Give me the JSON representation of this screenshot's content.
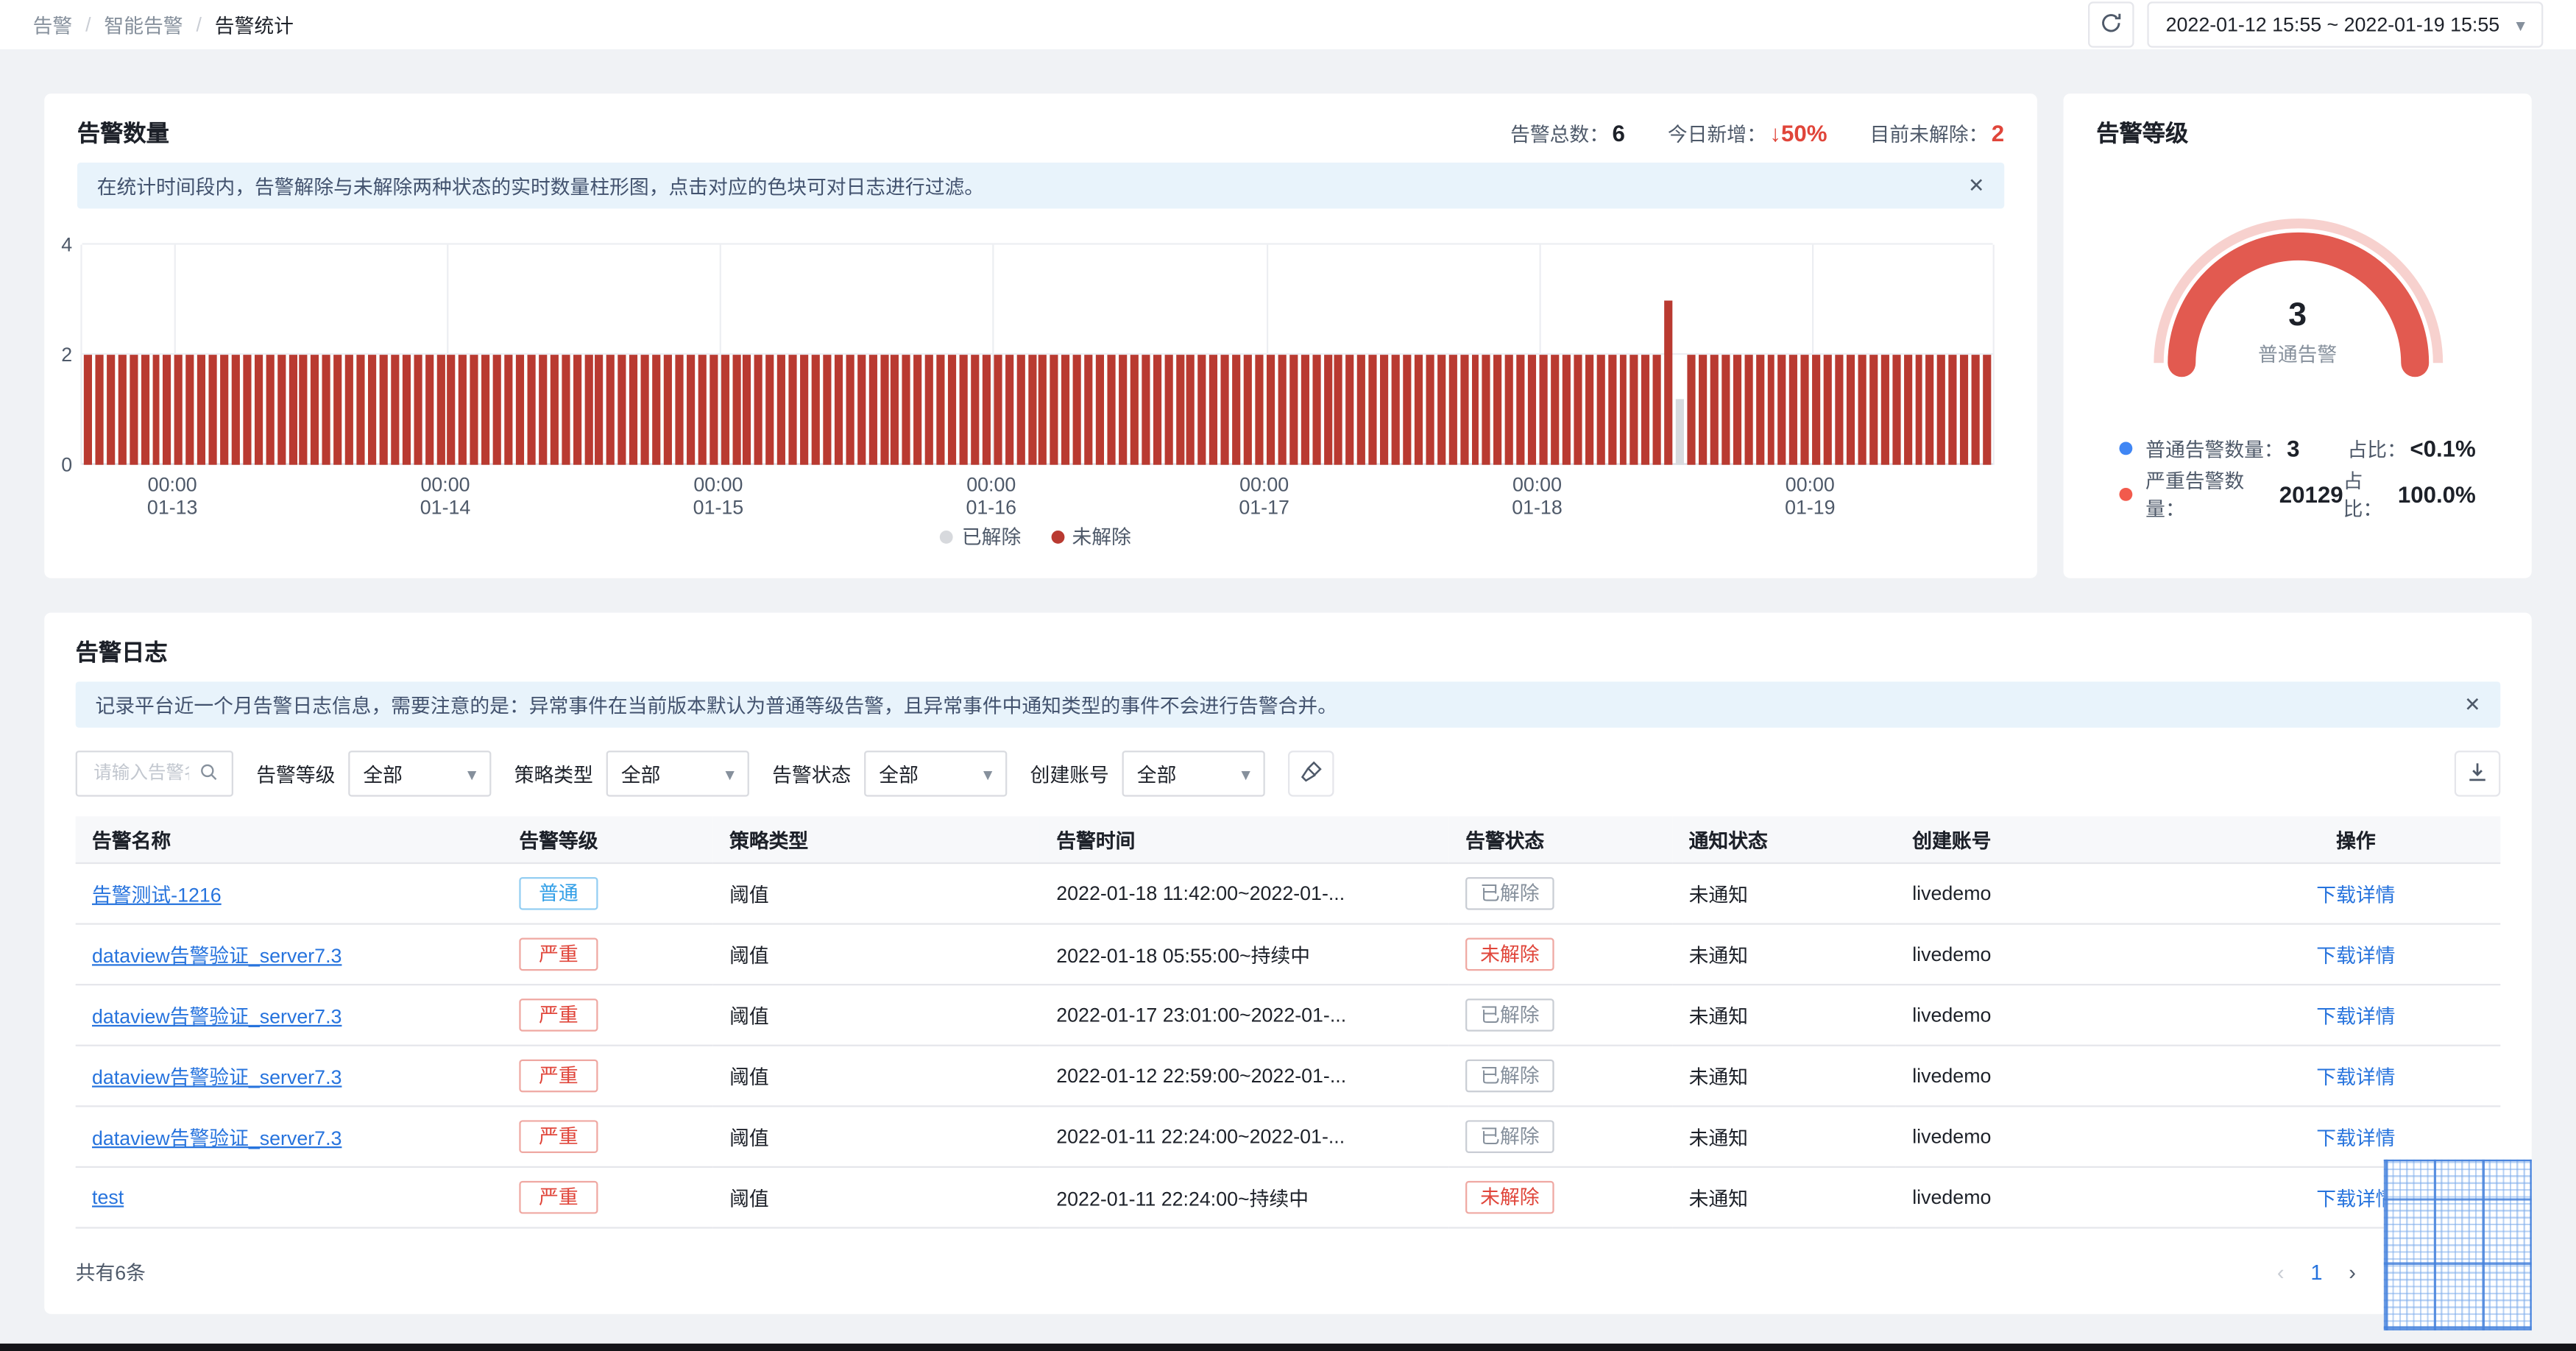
{
  "icons": {
    "chevron_down": "▾",
    "close": "✕",
    "pager_prev": "‹",
    "pager_next": "›"
  },
  "colors": {
    "accent_blue": "#2673dd",
    "danger_red": "#e0453a",
    "banner_bg": "#e8f3fb",
    "gauge_red": "#e25a50"
  },
  "topbar": {
    "breadcrumb": [
      "告警",
      "智能告警",
      "告警统计"
    ],
    "date_range": "2022-01-12 15:55 ~ 2022-01-19 15:55"
  },
  "alert_count_card": {
    "title": "告警数量",
    "stats": [
      {
        "label": "告警总数：",
        "value": "6",
        "tone": "dark"
      },
      {
        "label": "今日新增：",
        "value": "↓50%",
        "tone": "red"
      },
      {
        "label": "目前未解除：",
        "value": "2",
        "tone": "red"
      }
    ],
    "banner": "在统计时间段内，告警解除与未解除两种状态的实时数量柱形图，点击对应的色块可对日志进行过滤。"
  },
  "chart_data": {
    "type": "bar",
    "title": "",
    "xlabel": "",
    "ylabel": "",
    "ylim": [
      0,
      4
    ],
    "yticks": [
      0,
      2,
      4
    ],
    "grid": true,
    "legend_position": "bottom",
    "x_axis": {
      "start": "2022-01-12 15:55",
      "end": "2022-01-19 15:55",
      "total_hours": 168,
      "tick_hour_offsets": [
        8.08,
        32.08,
        56.08,
        80.08,
        104.08,
        128.08,
        152.08
      ],
      "tick_labels": [
        [
          "00:00",
          "01-13"
        ],
        [
          "00:00",
          "01-14"
        ],
        [
          "00:00",
          "01-15"
        ],
        [
          "00:00",
          "01-16"
        ],
        [
          "00:00",
          "01-17"
        ],
        [
          "00:00",
          "01-18"
        ],
        [
          "00:00",
          "01-19"
        ]
      ]
    },
    "bar_count": 168,
    "series": [
      {
        "name": "已解除",
        "color": "#d7d9dd",
        "default": 0,
        "overrides": {
          "140": 1.2
        }
      },
      {
        "name": "未解除",
        "color": "#b93a31",
        "default": 2,
        "overrides": {
          "139": 3,
          "140": 0
        }
      }
    ]
  },
  "alert_level_card": {
    "title": "告警等级",
    "gauge": {
      "value": "3",
      "label": "普通告警",
      "color": "#e25a50"
    },
    "rows": [
      {
        "dot": "#4086f4",
        "label": "普通告警数量：",
        "value": "3",
        "ratio_label": "占比：",
        "ratio": "<0.1%"
      },
      {
        "dot": "#f25a4c",
        "label": "严重告警数量：",
        "value": "20129",
        "ratio_label": "占比：",
        "ratio": "100.0%"
      }
    ]
  },
  "alert_log_card": {
    "title": "告警日志",
    "banner": "记录平台近一个月告警日志信息，需要注意的是：异常事件在当前版本默认为普通等级告警，且异常事件中通知类型的事件不会进行告警合并。",
    "filters": {
      "search_placeholder": "请输入告警名称",
      "selects": [
        {
          "label": "告警等级",
          "value": "全部"
        },
        {
          "label": "策略类型",
          "value": "全部"
        },
        {
          "label": "告警状态",
          "value": "全部"
        },
        {
          "label": "创建账号",
          "value": "全部"
        }
      ]
    },
    "table": {
      "columns": [
        "告警名称",
        "告警等级",
        "策略类型",
        "告警时间",
        "告警状态",
        "通知状态",
        "创建账号",
        "操作"
      ],
      "rows": [
        {
          "name": "告警测试-1216",
          "level": "普通",
          "level_tone": "blue",
          "policy": "阈值",
          "time": "2022-01-18 11:42:00~2022-01-...",
          "status": "已解除",
          "status_tone": "gray",
          "notify": "未通知",
          "account": "livedemo",
          "action": "下载详情"
        },
        {
          "name": "dataview告警验证_server7.3",
          "level": "严重",
          "level_tone": "red",
          "policy": "阈值",
          "time": "2022-01-18 05:55:00~持续中",
          "status": "未解除",
          "status_tone": "red",
          "notify": "未通知",
          "account": "livedemo",
          "action": "下载详情"
        },
        {
          "name": "dataview告警验证_server7.3",
          "level": "严重",
          "level_tone": "red",
          "policy": "阈值",
          "time": "2022-01-17 23:01:00~2022-01-...",
          "status": "已解除",
          "status_tone": "gray",
          "notify": "未通知",
          "account": "livedemo",
          "action": "下载详情"
        },
        {
          "name": "dataview告警验证_server7.3",
          "level": "严重",
          "level_tone": "red",
          "policy": "阈值",
          "time": "2022-01-12 22:59:00~2022-01-...",
          "status": "已解除",
          "status_tone": "gray",
          "notify": "未通知",
          "account": "livedemo",
          "action": "下载详情"
        },
        {
          "name": "dataview告警验证_server7.3",
          "level": "严重",
          "level_tone": "red",
          "policy": "阈值",
          "time": "2022-01-11 22:24:00~2022-01-...",
          "status": "已解除",
          "status_tone": "gray",
          "notify": "未通知",
          "account": "livedemo",
          "action": "下载详情"
        },
        {
          "name": "test",
          "level": "严重",
          "level_tone": "red",
          "policy": "阈值",
          "time": "2022-01-11 22:24:00~持续中",
          "status": "未解除",
          "status_tone": "red",
          "notify": "未通知",
          "account": "livedemo",
          "action": "下载详情"
        }
      ]
    },
    "pagination": {
      "total": "共有6条",
      "current_page": "1"
    }
  }
}
